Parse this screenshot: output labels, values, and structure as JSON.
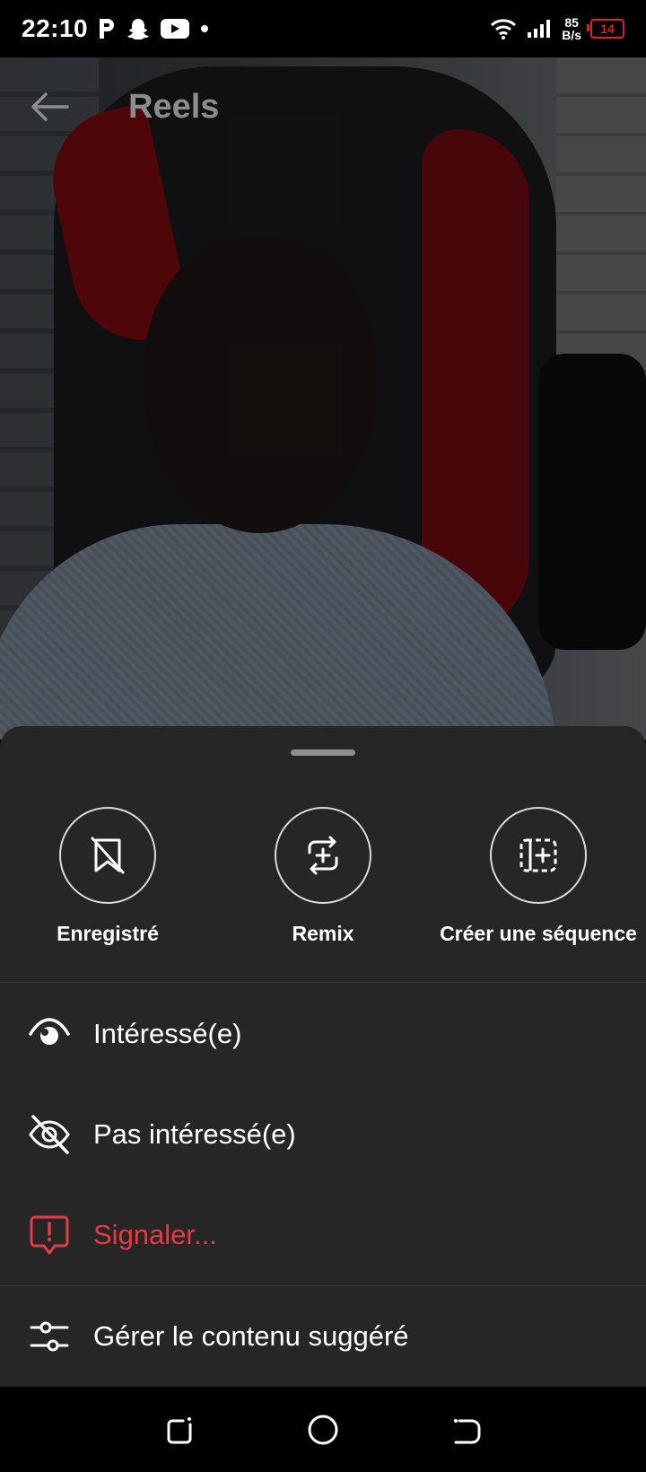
{
  "status_bar": {
    "time": "22:10",
    "net_speed_value": "85",
    "net_speed_unit": "B/s",
    "battery": "14",
    "icons": [
      "p-icon",
      "snapchat-icon",
      "youtube-icon",
      "dot-icon",
      "wifi-icon",
      "signal-icon",
      "battery-icon"
    ]
  },
  "header": {
    "title": "Reels",
    "back_icon": "arrow-left-icon"
  },
  "sheet": {
    "actions": [
      {
        "label": "Enregistré",
        "icon": "bookmark-slash-icon"
      },
      {
        "label": "Remix",
        "icon": "remix-icon"
      },
      {
        "label": "Créer une séquence",
        "icon": "sequence-icon"
      }
    ],
    "menu": [
      {
        "label": "Intéressé(e)",
        "icon": "eye-icon"
      },
      {
        "label": "Pas intéressé(e)",
        "icon": "eye-slash-icon"
      },
      {
        "label": "Signaler...",
        "icon": "report-icon",
        "color": "#e83a45"
      },
      {
        "label": "Gérer le contenu suggéré",
        "icon": "sliders-icon"
      }
    ]
  },
  "nav_bar": {
    "icons": [
      "recent-apps-icon",
      "home-icon",
      "back-icon"
    ]
  },
  "colors": {
    "sheet_bg": "#262626",
    "danger": "#e83a45"
  }
}
